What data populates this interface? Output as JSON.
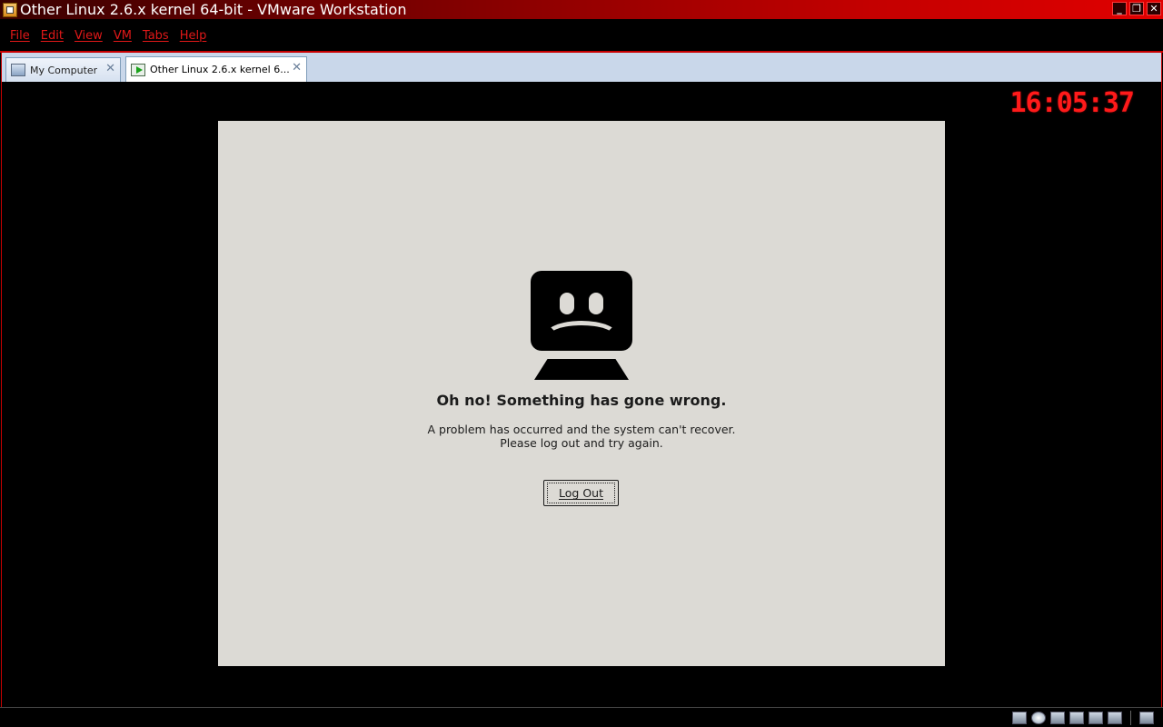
{
  "window": {
    "title": "Other Linux 2.6.x kernel 64-bit - VMware Workstation"
  },
  "menu": {
    "items": [
      "File",
      "Edit",
      "View",
      "VM",
      "Tabs",
      "Help"
    ]
  },
  "tabs": [
    {
      "label": "My Computer",
      "active": false
    },
    {
      "label": "Other Linux 2.6.x kernel 6...",
      "active": true
    }
  ],
  "console": {
    "clock": "16:05:37"
  },
  "guest": {
    "error_title": "Oh no!  Something has gone wrong.",
    "error_line1": "A problem has occurred and the system can't recover.",
    "error_line2": "Please log out and try again.",
    "logout_label": "Log Out"
  },
  "colors": {
    "accent": "#e01818",
    "guest_bg": "#dcdad5",
    "tab_strip": "#c9d7ea"
  }
}
